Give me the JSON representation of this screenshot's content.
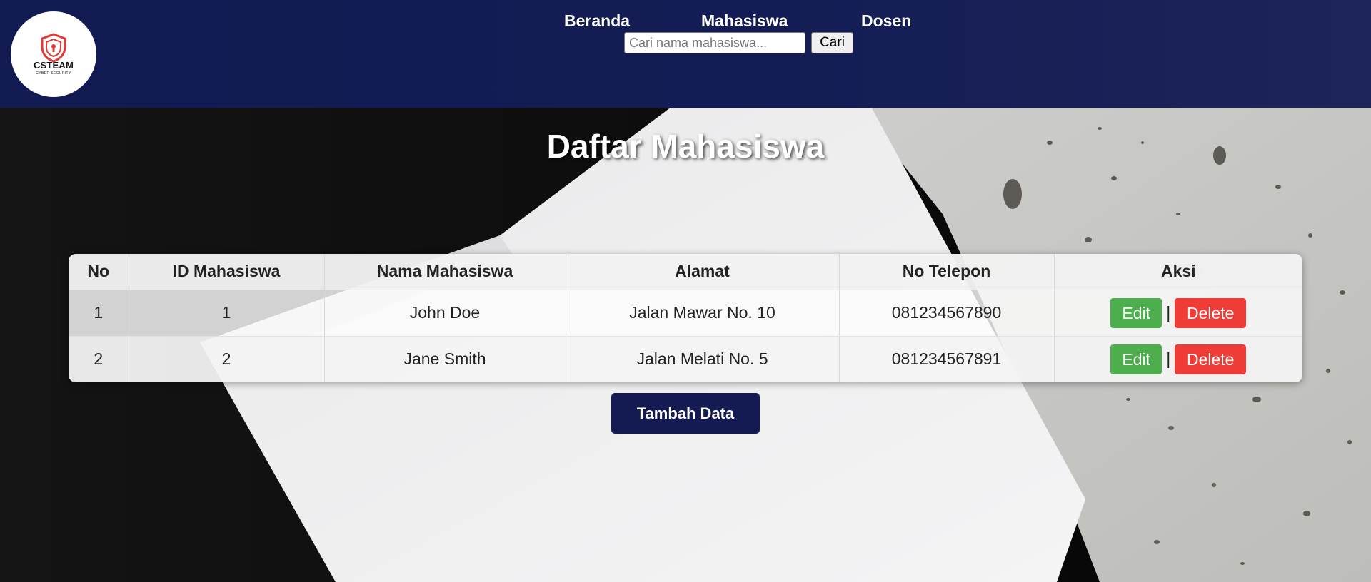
{
  "logo": {
    "name": "CSTEAM",
    "tagline": "CYBER SECURITY"
  },
  "nav": {
    "items": [
      {
        "label": "Beranda"
      },
      {
        "label": "Mahasiswa"
      },
      {
        "label": "Dosen"
      }
    ]
  },
  "search": {
    "placeholder": "Cari nama mahasiswa...",
    "value": "",
    "button_label": "Cari"
  },
  "page": {
    "title": "Daftar Mahasiswa"
  },
  "table": {
    "headers": [
      "No",
      "ID Mahasiswa",
      "Nama Mahasiswa",
      "Alamat",
      "No Telepon",
      "Aksi"
    ],
    "rows": [
      {
        "no": "1",
        "id": "1",
        "nama": "John Doe",
        "alamat": "Jalan Mawar No. 10",
        "telepon": "081234567890"
      },
      {
        "no": "2",
        "id": "2",
        "nama": "Jane Smith",
        "alamat": "Jalan Melati No. 5",
        "telepon": "081234567891"
      }
    ],
    "actions": {
      "edit_label": "Edit",
      "separator": "|",
      "delete_label": "Delete"
    }
  },
  "add_button_label": "Tambah Data",
  "colors": {
    "header_bg": "#141c55",
    "edit_button": "#4cae4c",
    "delete_button": "#f03c36",
    "add_button": "#141a52"
  },
  "icons": {
    "logo": "shield-icon"
  }
}
